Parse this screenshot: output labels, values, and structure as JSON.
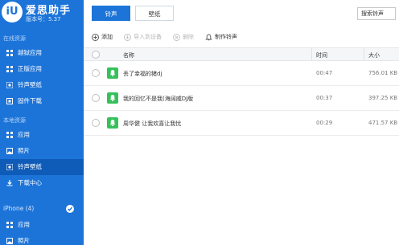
{
  "app": {
    "logo_text": "iU",
    "name": "爱思助手",
    "version": "版本号：5.37"
  },
  "sidebar": {
    "online_section": "在线资源",
    "online_items": [
      {
        "label": "越狱应用",
        "icon": "apps-icon"
      },
      {
        "label": "正版应用",
        "icon": "apps-icon"
      },
      {
        "label": "铃声壁纸",
        "icon": "ringtone-icon"
      },
      {
        "label": "固件下载",
        "icon": "firmware-icon"
      }
    ],
    "local_section": "本地资源",
    "local_items": [
      {
        "label": "应用",
        "icon": "apps-icon"
      },
      {
        "label": "照片",
        "icon": "photo-icon"
      },
      {
        "label": "铃声壁纸",
        "icon": "ringtone-icon",
        "active": true
      },
      {
        "label": "下载中心",
        "icon": "download-icon"
      }
    ],
    "device_title": "iPhone (4)",
    "device_items": [
      {
        "label": "应用",
        "icon": "apps-icon"
      },
      {
        "label": "照片",
        "icon": "photo-icon"
      }
    ]
  },
  "tabs": [
    {
      "label": "铃声",
      "active": true
    },
    {
      "label": "壁纸",
      "active": false
    }
  ],
  "search": {
    "placeholder": "搜索铃声"
  },
  "toolbar": {
    "add": "添加",
    "import_device": "导入到设备",
    "delete": "删除",
    "make_ringtone": "制作铃声"
  },
  "table": {
    "headers": {
      "name": "名称",
      "time": "时间",
      "size": "大小"
    },
    "rows": [
      {
        "name": "丢了幸福的猪dj",
        "time": "00:47",
        "size": "756.01 KB"
      },
      {
        "name": "我的回忆不是我(海阔威DJ版",
        "time": "00:37",
        "size": "397.25 KB"
      },
      {
        "name": "周华健 让我欢喜让我忧",
        "time": "00:29",
        "size": "471.57 KB"
      }
    ]
  },
  "colors": {
    "brand": "#1c74d9",
    "active_nav": "#0f5bb8",
    "ringtone_icon": "#35c15a"
  }
}
